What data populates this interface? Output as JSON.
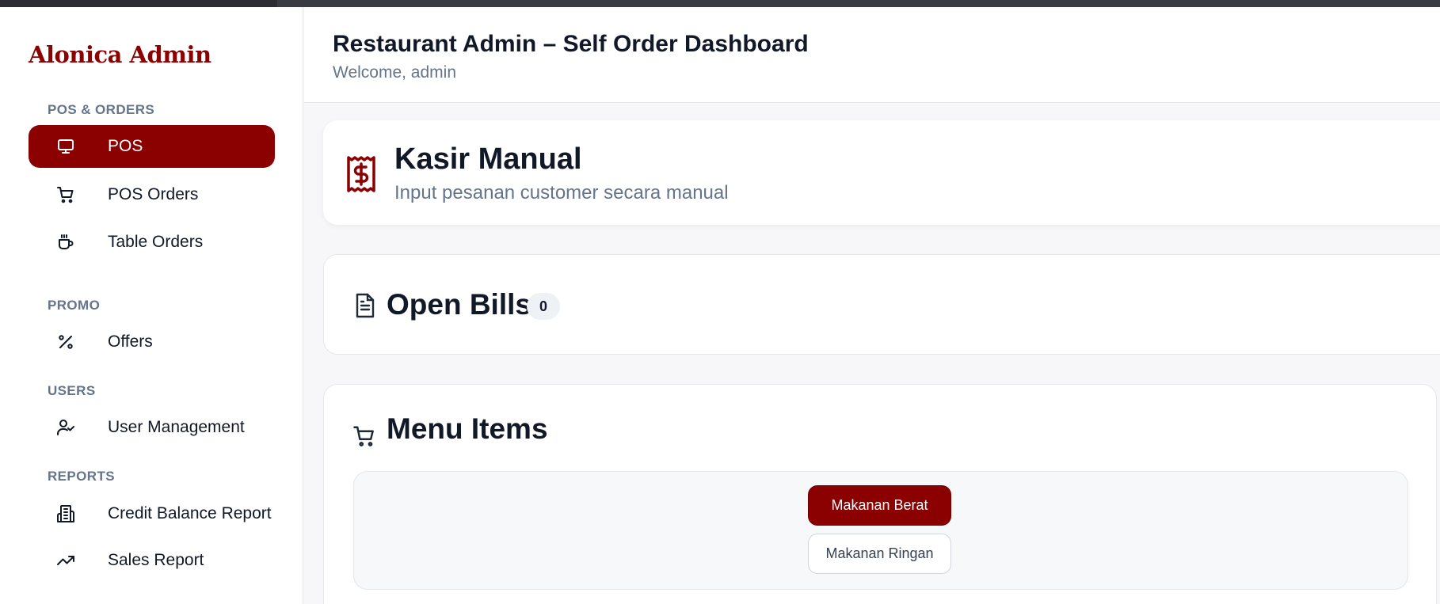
{
  "app": {
    "brand": "Alonica Admin",
    "accent_color": "#8b0000"
  },
  "sidebar": {
    "sections": [
      {
        "label": "POS & ORDERS"
      },
      {
        "label": "PROMO"
      },
      {
        "label": "USERS"
      },
      {
        "label": "REPORTS"
      }
    ],
    "items": [
      {
        "label": "POS",
        "icon": "monitor-icon",
        "active": true
      },
      {
        "label": "POS Orders",
        "icon": "cart-icon"
      },
      {
        "label": "Table Orders",
        "icon": "coffee-cup-icon"
      },
      {
        "label": "Offers",
        "icon": "percent-icon"
      },
      {
        "label": "User Management",
        "icon": "user-check-icon"
      },
      {
        "label": "Credit Balance Report",
        "icon": "building-icon"
      },
      {
        "label": "Sales Report",
        "icon": "trending-up-icon"
      }
    ]
  },
  "header": {
    "title": "Restaurant Admin – Self Order Dashboard",
    "subtitle": "Welcome, admin"
  },
  "kasir": {
    "title": "Kasir Manual",
    "subtitle": "Input pesanan customer secara manual",
    "icon": "receipt-icon"
  },
  "open_bills": {
    "title": "Open Bills",
    "count": "0",
    "icon": "document-icon"
  },
  "menu_items": {
    "title": "Menu Items",
    "icon": "cart-icon",
    "categories": [
      {
        "label": "Makanan Berat",
        "active": true
      },
      {
        "label": "Makanan Ringan",
        "active": false
      }
    ]
  }
}
